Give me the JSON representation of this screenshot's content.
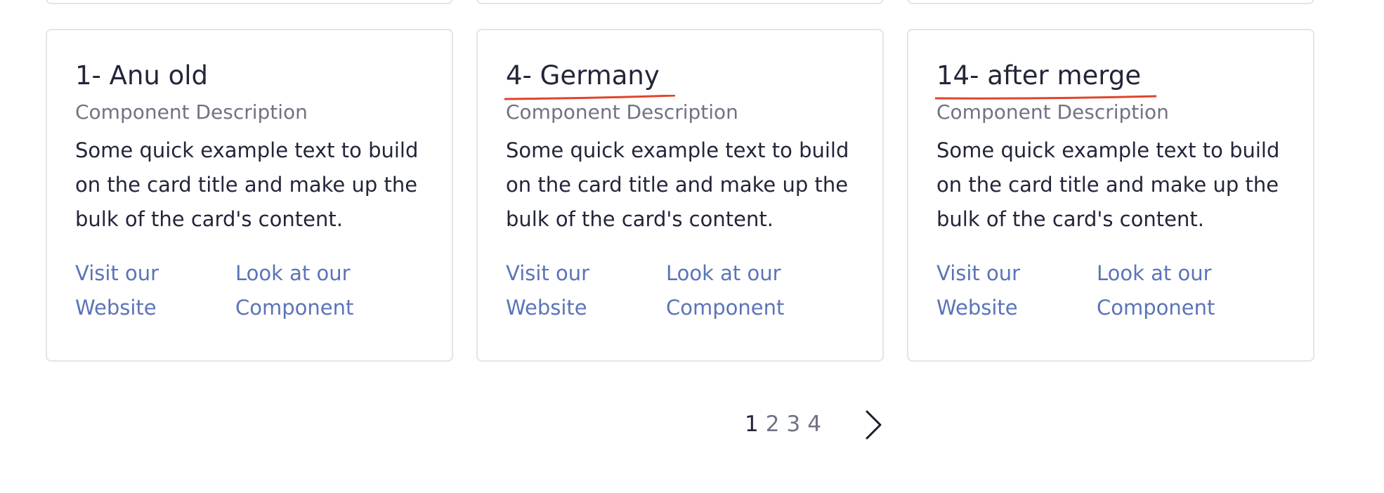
{
  "cards": [
    {
      "title": "1- Anu old",
      "subtitle": "Component Description",
      "text": "Some quick example text to build on the card title and make up the bulk of the card's content.",
      "link_website": "Visit our Website",
      "link_component": "Look at our Component"
    },
    {
      "title": "4- Germany",
      "subtitle": "Component Description",
      "text": "Some quick example text to build on the card title and make up the bulk of the card's content.",
      "link_website": "Visit our Website",
      "link_component": "Look at our Component"
    },
    {
      "title": "14- after merge",
      "subtitle": "Component Description",
      "text": "Some quick example text to build on the card title and make up the bulk of the card's content.",
      "link_website": "Visit our Website",
      "link_component": "Look at our Component"
    }
  ],
  "pagination": {
    "pages": [
      "1",
      "2",
      "3",
      "4"
    ],
    "current": "1",
    "next_icon": "chevron-right-icon"
  },
  "colors": {
    "text": "#23253a",
    "muted": "#707383",
    "link": "#5b74b8",
    "annotation": "#e0452b",
    "border": "#e3e4e8"
  }
}
